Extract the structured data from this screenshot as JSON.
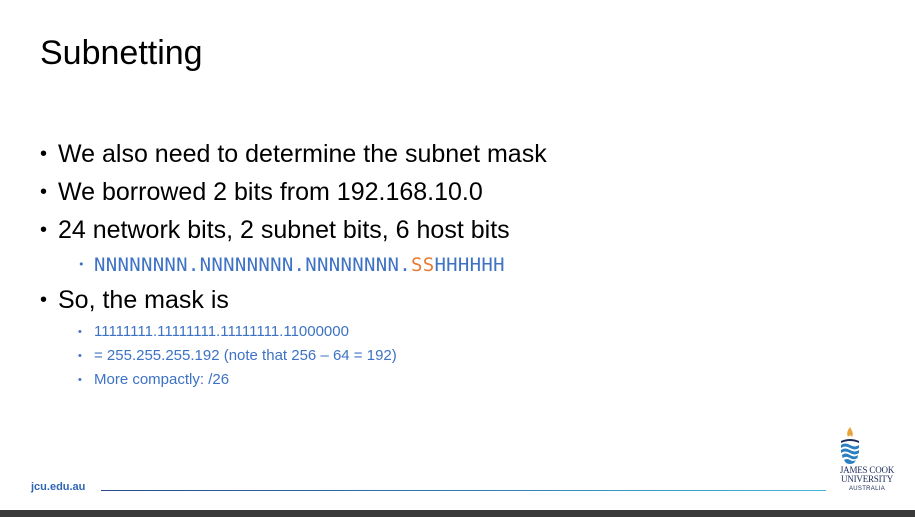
{
  "slide": {
    "title": "Subnetting",
    "bullets": [
      {
        "text": "We also need to determine the subnet mask"
      },
      {
        "text": "We borrowed 2 bits from 192.168.10.0"
      },
      {
        "text": "24 network bits, 2 subnet bits, 6 host bits"
      }
    ],
    "bit_pattern": {
      "network_part": "NNNNNNNN.NNNNNNNN.NNNNNNNN.",
      "subnet_part": "SS",
      "host_part": "HHHHHH"
    },
    "mask_bullet": "So, the mask is",
    "mask_details": [
      "11111111.11111111.11111111.11000000",
      "= 255.255.255.192 (note that 256 – 64 = 192)",
      "More compactly: /26"
    ],
    "bullet_glyph": "•"
  },
  "footer": {
    "link": "jcu.edu.au",
    "logo_line1": "JAMES COOK",
    "logo_line2": "UNIVERSITY",
    "logo_line3": "AUSTRALIA"
  },
  "colors": {
    "accent_blue": "#3d72c4",
    "subnet_orange": "#e97a34",
    "logo_navy": "#1c2d5a"
  }
}
